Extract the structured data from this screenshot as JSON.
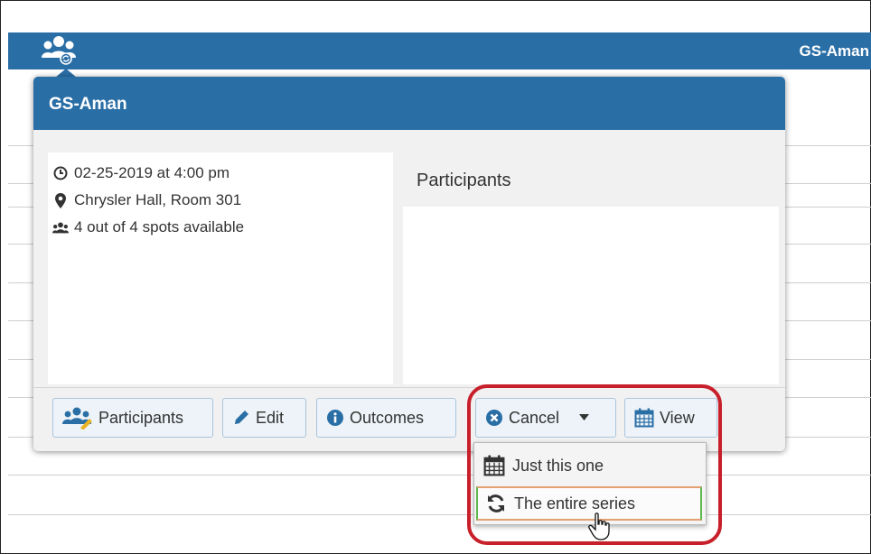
{
  "topbar": {
    "title": "GS-Aman",
    "icon": "users-cycle-icon"
  },
  "modal": {
    "title": "GS-Aman",
    "info": {
      "datetime": "02-25-2019 at 4:00 pm",
      "location": "Chrysler Hall, Room 301",
      "spots": "4 out of 4 spots available"
    },
    "participants_heading": "Participants"
  },
  "toolbar": {
    "participants_label": "Participants",
    "edit_label": "Edit",
    "outcomes_label": "Outcomes",
    "cancel_label": "Cancel",
    "view_label": "View"
  },
  "cancel_menu": {
    "items": [
      {
        "label": "Just this one",
        "icon": "calendar-icon"
      },
      {
        "label": "The entire series",
        "icon": "refresh-icon"
      }
    ]
  },
  "colors": {
    "header": "#2a6ea6",
    "highlight": "#c8202b",
    "button_bg": "#edf3f8"
  }
}
